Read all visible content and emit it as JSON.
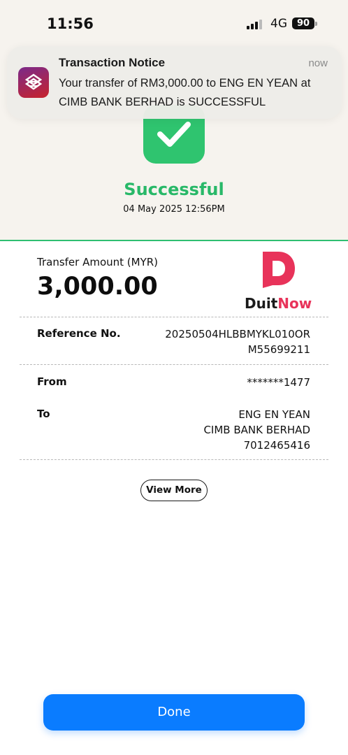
{
  "status_bar": {
    "time": "11:56",
    "network": "4G",
    "battery": "90"
  },
  "notification": {
    "title": "Transaction Notice",
    "time": "now",
    "body": "Your transfer of RM3,000.00 to ENG EN YEAN at CIMB BANK BERHAD is SUCCESSFUL",
    "icon": "bank-app-icon"
  },
  "result": {
    "status": "Successful",
    "datetime": "04 May 2025 12:56PM",
    "icon": "check-icon",
    "accent_color": "#2fc46f"
  },
  "transfer": {
    "amount_label": "Transfer Amount (MYR)",
    "amount": "3,000.00",
    "logo": {
      "brand_part1": "Duit",
      "brand_part2": "Now",
      "color": "#e8335a"
    }
  },
  "details": {
    "reference_label": "Reference No.",
    "reference_line1": "20250504HLBBMYKL010OR",
    "reference_line2": "M55699211",
    "from_label": "From",
    "from_value": "*******1477",
    "to_label": "To",
    "to_name": "ENG EN YEAN",
    "to_bank": "CIMB BANK BERHAD",
    "to_account": "7012465416"
  },
  "actions": {
    "view_more": "View More",
    "done": "Done",
    "done_color": "#0a7cff"
  }
}
